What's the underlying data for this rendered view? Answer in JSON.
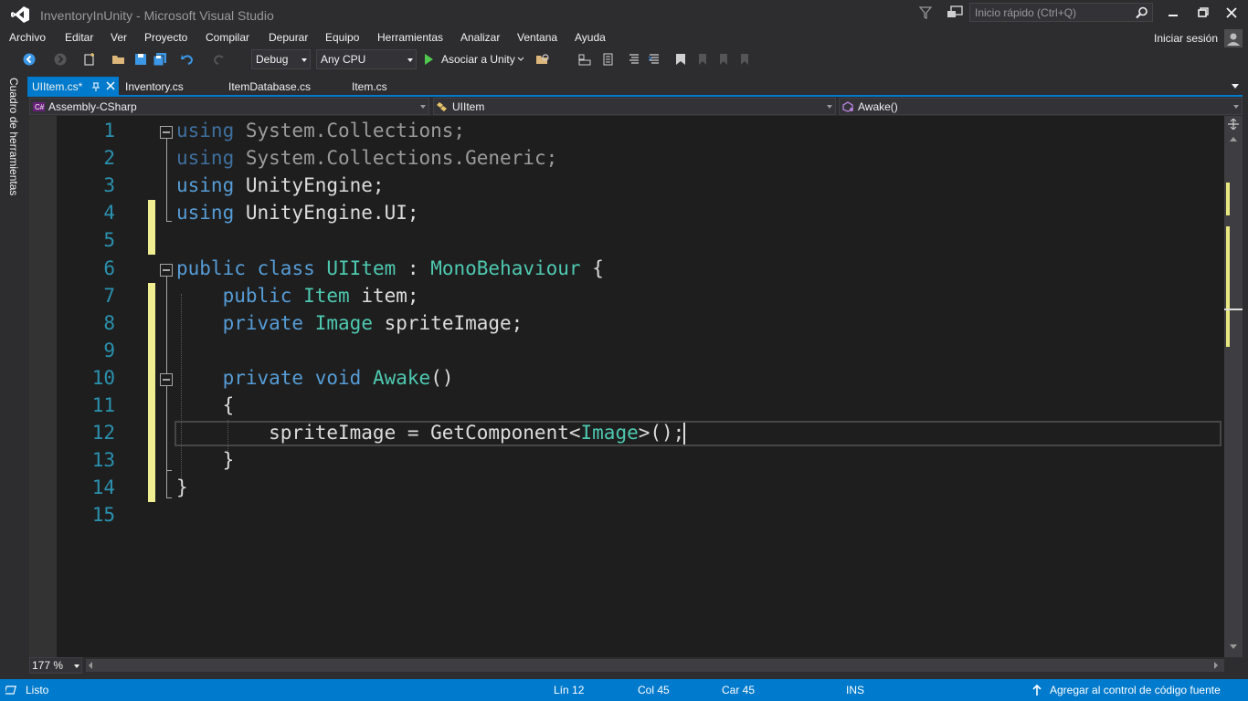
{
  "window": {
    "title": "InventoryInUnity - Microsoft Visual Studio",
    "quick_launch_placeholder": "Inicio rápido (Ctrl+Q)",
    "sign_in": "Iniciar sesión"
  },
  "menu": {
    "items": [
      {
        "label": "Archivo"
      },
      {
        "label": "Editar"
      },
      {
        "label": "Ver"
      },
      {
        "label": "Proyecto"
      },
      {
        "label": "Compilar"
      },
      {
        "label": "Depurar"
      },
      {
        "label": "Equipo"
      },
      {
        "label": "Herramientas"
      },
      {
        "label": "Analizar"
      },
      {
        "label": "Ventana"
      },
      {
        "label": "Ayuda"
      }
    ]
  },
  "toolbar": {
    "configuration": "Debug",
    "platform": "Any CPU",
    "run_label": "Asociar a Unity"
  },
  "toolbox": {
    "label": "Cuadro de herramientas"
  },
  "tabs": [
    {
      "label": "UIItem.cs*",
      "active": true
    },
    {
      "label": "Inventory.cs",
      "active": false
    },
    {
      "label": "ItemDatabase.cs",
      "active": false
    },
    {
      "label": "Item.cs",
      "active": false
    }
  ],
  "navbar": {
    "project": "Assembly-CSharp",
    "type": "UIItem",
    "member": "Awake()"
  },
  "code": {
    "line_numbers": [
      "1",
      "2",
      "3",
      "4",
      "5",
      "6",
      "7",
      "8",
      "9",
      "10",
      "11",
      "12",
      "13",
      "14",
      "15"
    ],
    "lines": [
      [
        {
          "t": "using",
          "c": "dimkw"
        },
        {
          "t": " System.Collections;",
          "c": "dim"
        }
      ],
      [
        {
          "t": "using",
          "c": "dimkw"
        },
        {
          "t": " System.Collections.Generic;",
          "c": "dim"
        }
      ],
      [
        {
          "t": "using",
          "c": "kw"
        },
        {
          "t": " UnityEngine;",
          "c": ""
        }
      ],
      [
        {
          "t": "using",
          "c": "kw"
        },
        {
          "t": " UnityEngine.UI;",
          "c": ""
        }
      ],
      [],
      [
        {
          "t": "public",
          "c": "kw"
        },
        {
          "t": " ",
          "c": ""
        },
        {
          "t": "class",
          "c": "kw"
        },
        {
          "t": " ",
          "c": ""
        },
        {
          "t": "UIItem",
          "c": "ty"
        },
        {
          "t": " : ",
          "c": ""
        },
        {
          "t": "MonoBehaviour",
          "c": "ty"
        },
        {
          "t": " {",
          "c": ""
        }
      ],
      [
        {
          "t": "    ",
          "c": ""
        },
        {
          "t": "public",
          "c": "kw"
        },
        {
          "t": " ",
          "c": ""
        },
        {
          "t": "Item",
          "c": "ty"
        },
        {
          "t": " item;",
          "c": ""
        }
      ],
      [
        {
          "t": "    ",
          "c": ""
        },
        {
          "t": "private",
          "c": "kw"
        },
        {
          "t": " ",
          "c": ""
        },
        {
          "t": "Image",
          "c": "ty"
        },
        {
          "t": " spriteImage;",
          "c": ""
        }
      ],
      [],
      [
        {
          "t": "    ",
          "c": ""
        },
        {
          "t": "private",
          "c": "kw"
        },
        {
          "t": " ",
          "c": ""
        },
        {
          "t": "void",
          "c": "kw"
        },
        {
          "t": " ",
          "c": ""
        },
        {
          "t": "Awake",
          "c": "ty"
        },
        {
          "t": "()",
          "c": ""
        }
      ],
      [
        {
          "t": "    {",
          "c": ""
        }
      ],
      [
        {
          "t": "        spriteImage = GetComponent<",
          "c": ""
        },
        {
          "t": "Image",
          "c": "ty"
        },
        {
          "t": ">();",
          "c": ""
        }
      ],
      [
        {
          "t": "    }",
          "c": ""
        }
      ],
      [
        {
          "t": "}",
          "c": ""
        }
      ],
      []
    ]
  },
  "editor": {
    "zoom": "177 %"
  },
  "status": {
    "state": "Listo",
    "line": "Lín 12",
    "col": "Col 45",
    "char": "Car 45",
    "mode": "INS",
    "source_control": "Agregar al control de código fuente"
  }
}
